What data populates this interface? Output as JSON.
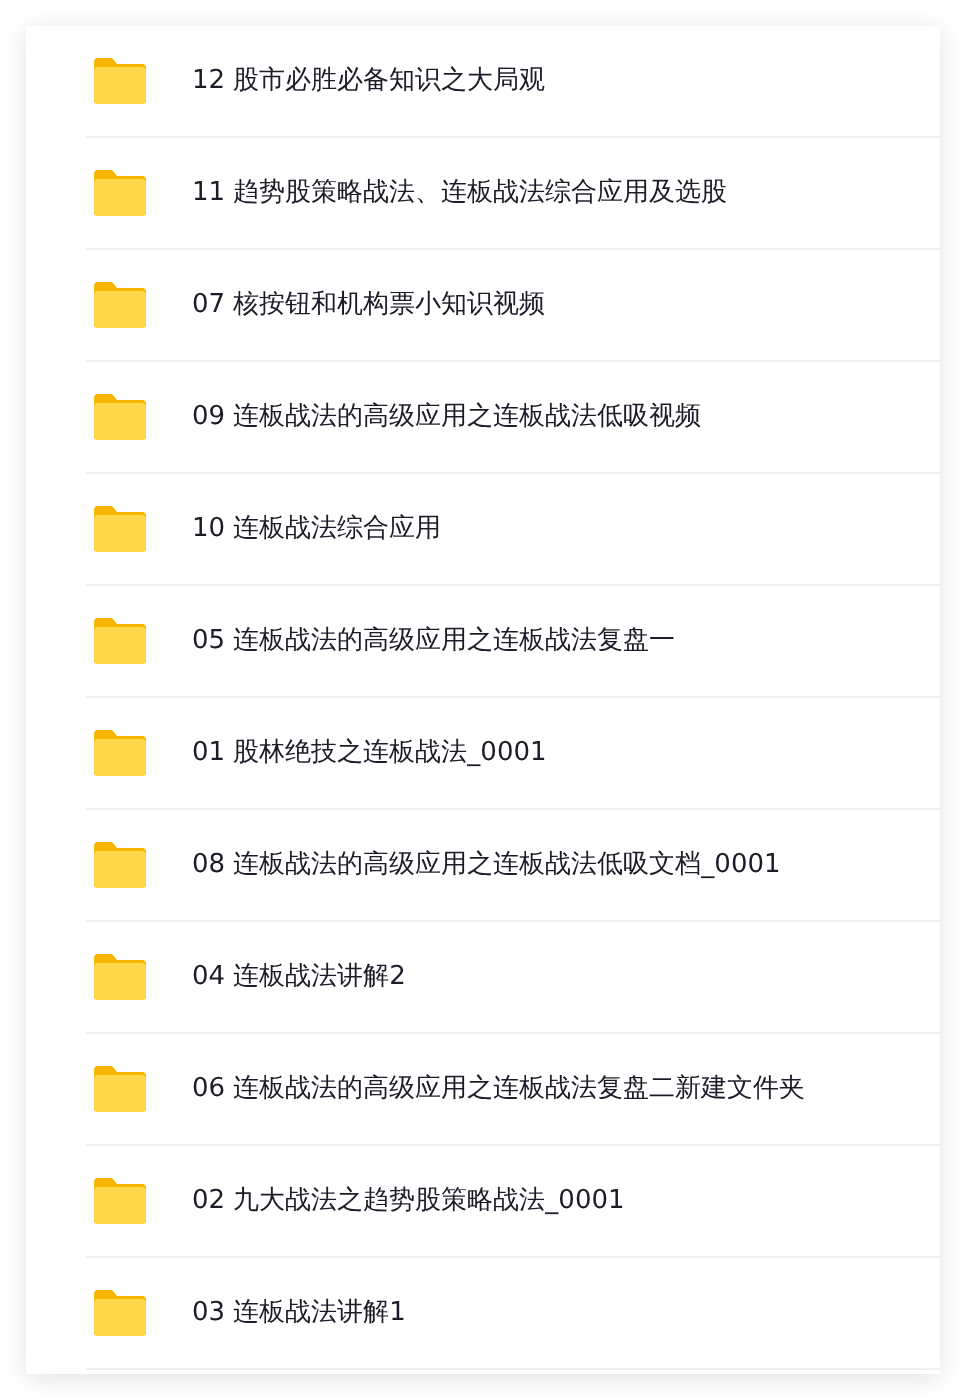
{
  "folders": [
    {
      "name": "12 股市必胜必备知识之大局观"
    },
    {
      "name": "11 趋势股策略战法、连板战法综合应用及选股"
    },
    {
      "name": "07 核按钮和机构票小知识视频"
    },
    {
      "name": "09 连板战法的高级应用之连板战法低吸视频"
    },
    {
      "name": "10 连板战法综合应用"
    },
    {
      "name": "05 连板战法的高级应用之连板战法复盘一"
    },
    {
      "name": "01 股林绝技之连板战法_0001"
    },
    {
      "name": "08 连板战法的高级应用之连板战法低吸文档_0001"
    },
    {
      "name": "04 连板战法讲解2"
    },
    {
      "name": "06 连板战法的高级应用之连板战法复盘二新建文件夹"
    },
    {
      "name": "02 九大战法之趋势股策略战法_0001"
    },
    {
      "name": "03 连板战法讲解1"
    }
  ]
}
